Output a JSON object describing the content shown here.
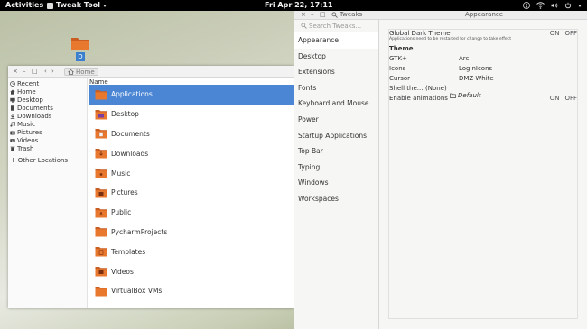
{
  "topbar": {
    "activities": "Activities",
    "app_menu": "Tweak Tool",
    "clock": "Fri Apr 22, 17:11"
  },
  "desktop": {
    "icon_label": "D"
  },
  "files": {
    "breadcrumb": "Home",
    "sidebar": [
      {
        "label": "Recent",
        "icon": "clock-icon"
      },
      {
        "label": "Home",
        "icon": "home-icon"
      },
      {
        "label": "Desktop",
        "icon": "desktop-icon"
      },
      {
        "label": "Documents",
        "icon": "document-icon"
      },
      {
        "label": "Downloads",
        "icon": "download-icon"
      },
      {
        "label": "Music",
        "icon": "music-icon"
      },
      {
        "label": "Pictures",
        "icon": "camera-icon"
      },
      {
        "label": "Videos",
        "icon": "video-icon"
      },
      {
        "label": "Trash",
        "icon": "trash-icon"
      }
    ],
    "other_locations": "Other Locations",
    "column_name": "Name",
    "items": [
      {
        "name": "Applications",
        "selected": true
      },
      {
        "name": "Desktop",
        "selected": false
      },
      {
        "name": "Documents",
        "selected": false
      },
      {
        "name": "Downloads",
        "selected": false
      },
      {
        "name": "Music",
        "selected": false
      },
      {
        "name": "Pictures",
        "selected": false
      },
      {
        "name": "Public",
        "selected": false
      },
      {
        "name": "PycharmProjects",
        "selected": false
      },
      {
        "name": "Templates",
        "selected": false
      },
      {
        "name": "Videos",
        "selected": false
      },
      {
        "name": "VirtualBox VMs",
        "selected": false
      }
    ]
  },
  "tweaks": {
    "title_app": "Tweaks",
    "title_section": "Appearance",
    "search_placeholder": "Search Tweaks...",
    "nav": [
      {
        "label": "Appearance",
        "active": true
      },
      {
        "label": "Desktop",
        "active": false
      },
      {
        "label": "Extensions",
        "active": false
      },
      {
        "label": "Fonts",
        "active": false
      },
      {
        "label": "Keyboard and Mouse",
        "active": false
      },
      {
        "label": "Power",
        "active": false
      },
      {
        "label": "Startup Applications",
        "active": false
      },
      {
        "label": "Top Bar",
        "active": false
      },
      {
        "label": "Typing",
        "active": false
      },
      {
        "label": "Windows",
        "active": false
      },
      {
        "label": "Workspaces",
        "active": false
      }
    ],
    "dark_theme": {
      "label": "Global Dark Theme",
      "note": "Applications need to be restarted for change to take effect",
      "on": "ON",
      "off": "OFF"
    },
    "theme_heading": "Theme",
    "theme_rows": [
      {
        "label": "GTK+",
        "value": "Arc"
      },
      {
        "label": "Icons",
        "value": "LoginIcons"
      },
      {
        "label": "Cursor",
        "value": "DMZ-White"
      }
    ],
    "shell": {
      "label": "Shell the...",
      "none": "(None)",
      "value": "Default"
    },
    "animations": {
      "label": "Enable animations",
      "on": "ON",
      "off": "OFF"
    }
  },
  "colors": {
    "selection": "#4a86d4",
    "folder": "#e8782e",
    "topbar": "#000000"
  }
}
